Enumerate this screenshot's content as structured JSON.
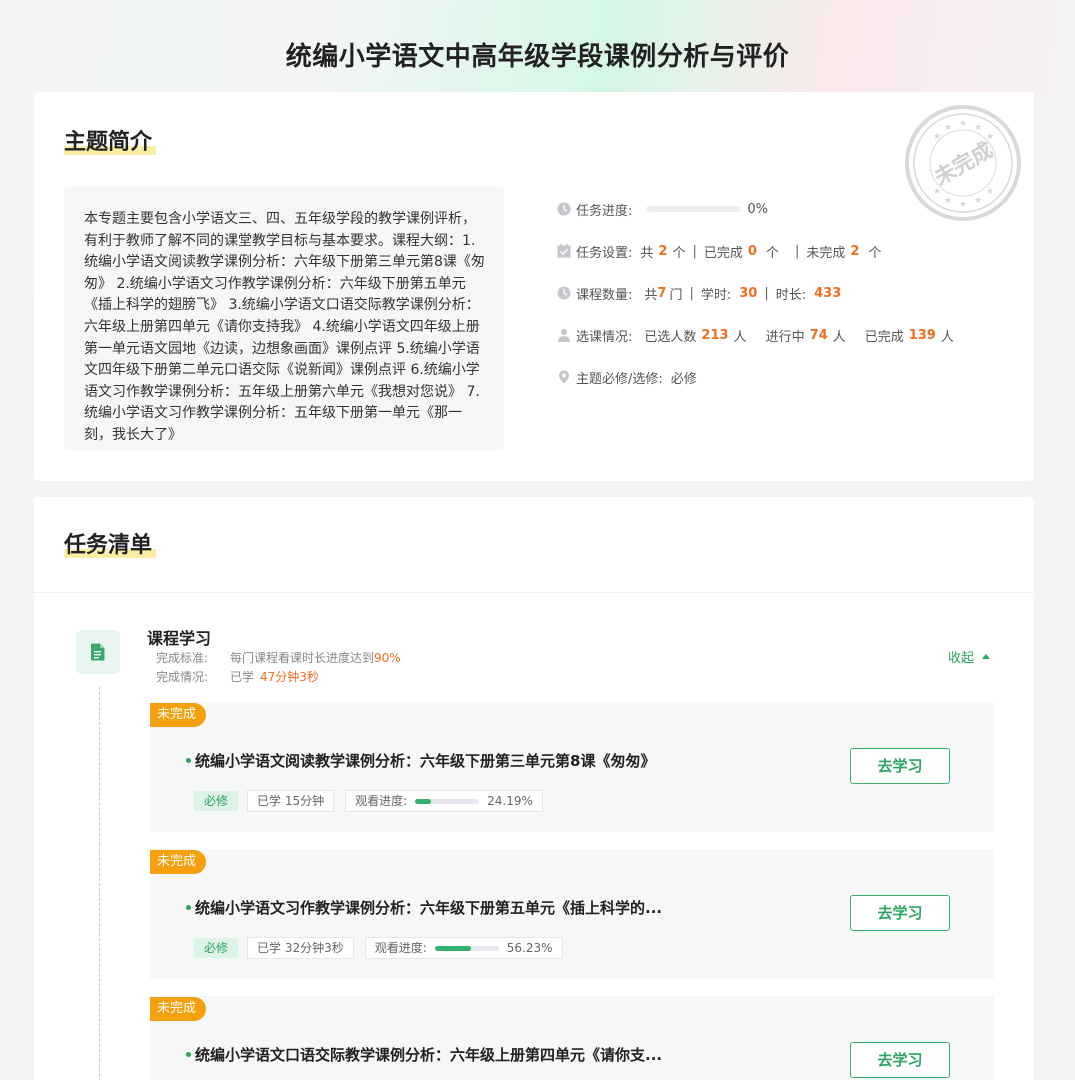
{
  "page": {
    "title": "统编小学语文中高年级学段课例分析与评价"
  },
  "intro": {
    "heading": "主题简介",
    "stamp_text": "未完成",
    "description": "本专题主要包含小学语文三、四、五年级学段的教学课例评析，有利于教师了解不同的课堂教学目标与基本要求。课程大纲：1.统编小学语文阅读教学课例分析：六年级下册第三单元第8课《匆匆》 2.统编小学语文习作教学课例分析：六年级下册第五单元《插上科学的翅膀飞》 3.统编小学语文口语交际教学课例分析：六年级上册第四单元《请你支持我》 4.统编小学语文四年级上册第一单元语文园地《边读，边想象画面》课例点评 5.统编小学语文四年级下册第二单元口语交际《说新闻》课例点评 6.统编小学语文习作教学课例分析：五年级上册第六单元《我想对您说》 7.统编小学语文习作教学课例分析：五年级下册第一单元《那一刻，我长大了》",
    "progress": {
      "label": "任务进度:",
      "value": 0,
      "text": "0%"
    },
    "task_settings": {
      "label": "任务设置:",
      "total_prefix": "共",
      "total": "2",
      "unit": "个",
      "sep": "|",
      "done_label": "已完成",
      "done": "0",
      "undone_label": "未完成",
      "undone": "2"
    },
    "course_count": {
      "label": "课程数量:",
      "prefix": "共",
      "count": "7",
      "unit": "门",
      "sep": "|",
      "hours_label": "学时:",
      "hours": "30",
      "duration_label": "时长:",
      "duration": "433"
    },
    "enrollment": {
      "label": "选课情况:",
      "selected_label": "已选人数",
      "selected": "213",
      "unit": "人",
      "ongoing_label": "进行中",
      "ongoing": "74",
      "completed_label": "已完成",
      "completed": "139"
    },
    "required": {
      "label": "主题必修/选修:",
      "value": "必修"
    }
  },
  "tasks": {
    "heading": "任务清单",
    "group": {
      "title": "课程学习",
      "criteria_label": "完成标准:",
      "criteria_prefix": "每门课程看课时长进度达到",
      "criteria_value": "90%",
      "status_label": "完成情况:",
      "status_prefix": "已学",
      "status_value": "47分钟3秒",
      "collapse_label": "收起"
    },
    "items": [
      {
        "tag": "未完成",
        "title": "统编小学语文阅读教学课例分析：六年级下册第三单元第8课《匆匆》",
        "required": "必修",
        "studied": "已学 15分钟",
        "progress_label": "观看进度:",
        "progress": 24.19,
        "progress_text": "24.19%",
        "button": "去学习"
      },
      {
        "tag": "未完成",
        "title": "统编小学语文习作教学课例分析：六年级下册第五单元《插上科学的...",
        "required": "必修",
        "studied": "已学 32分钟3秒",
        "progress_label": "观看进度:",
        "progress": 56.23,
        "progress_text": "56.23%",
        "button": "去学习"
      },
      {
        "tag": "未完成",
        "title": "统编小学语文口语交际教学课例分析：六年级上册第四单元《请你支...",
        "button": "去学习"
      }
    ]
  }
}
